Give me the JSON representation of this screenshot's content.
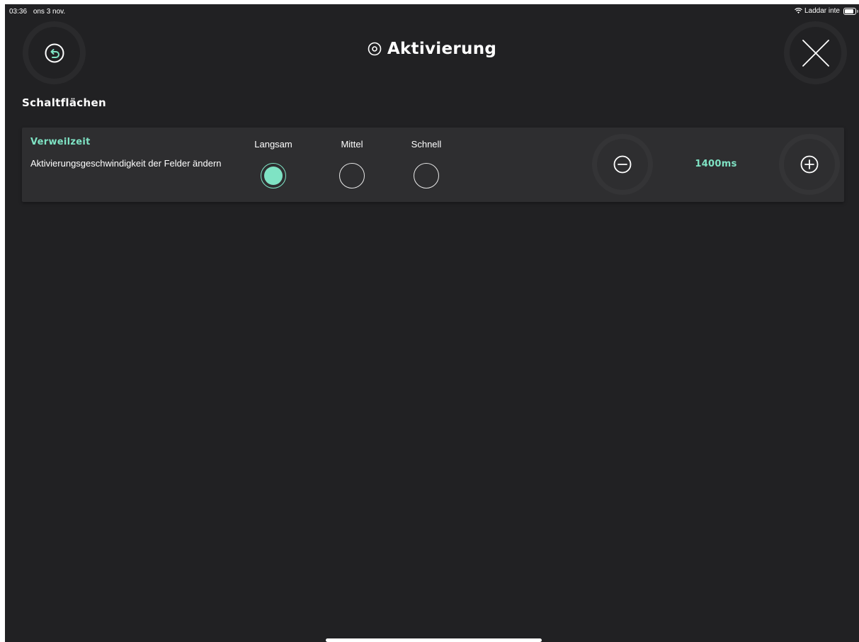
{
  "status_bar": {
    "time": "03:36",
    "date": "ons 3 nov.",
    "charging": "Laddar inte"
  },
  "header": {
    "title": "Aktivierung",
    "title_icon": "target-icon",
    "back_icon": "undo-icon",
    "close_icon": "close-icon"
  },
  "section": {
    "title": "Schaltflächen"
  },
  "setting": {
    "title": "Verweilzeit",
    "description": "Aktivierungsgeschwindigkeit der Felder ändern",
    "options": [
      {
        "label": "Langsam",
        "selected": true
      },
      {
        "label": "Mittel",
        "selected": false
      },
      {
        "label": "Schnell",
        "selected": false
      }
    ],
    "value": "1400ms",
    "decrease_icon": "minus-circle-icon",
    "increase_icon": "plus-circle-icon"
  },
  "colors": {
    "background": "#212123",
    "card": "#2e2e30",
    "accent": "#7fe3c4",
    "text": "#ffffff"
  }
}
